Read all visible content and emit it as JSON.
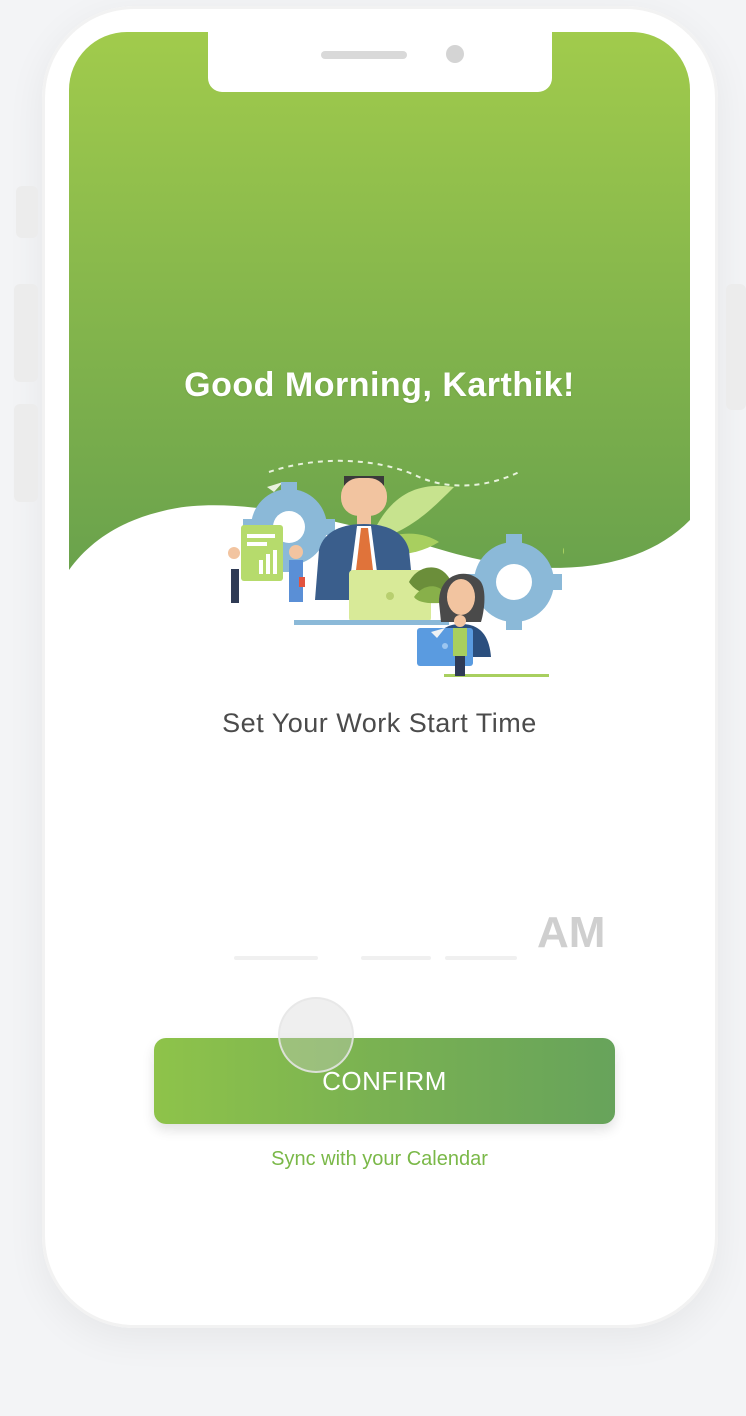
{
  "greeting": "Good Morning, Karthik!",
  "subtitle": "Set Your Work Start Time",
  "time_picker": {
    "period": "AM"
  },
  "confirm_label": "CONFIRM",
  "sync_label": "Sync with your Calendar",
  "colors": {
    "accent_green_light": "#8ec34a",
    "accent_green_dark": "#67a35b",
    "link_green": "#7ab848"
  },
  "illustration": "team-working-illustration-icon"
}
